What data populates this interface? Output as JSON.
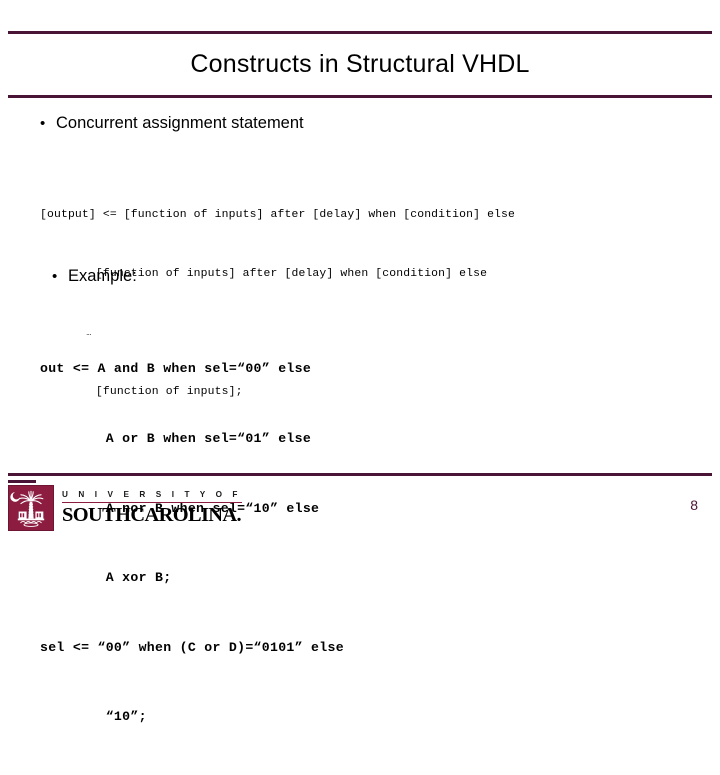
{
  "slide": {
    "title": "Constructs in Structural VHDL",
    "page_number": "8",
    "accent_color": "#4a1436",
    "logo_color": "#8c1d40"
  },
  "bullets": [
    {
      "marker": "•",
      "label": "Concurrent assignment statement"
    },
    {
      "marker": "•",
      "label": "Example:"
    }
  ],
  "code_syntax": {
    "line1": "[output] <= [function of inputs] after [delay] when [condition] else",
    "line2": "        [function of inputs] after [delay] when [condition] else",
    "line3": "        …",
    "line4": "        [function of inputs];"
  },
  "code_example": {
    "line1": "out <= A and B when sel=“00” else",
    "line2": "        A or B when sel=“01” else",
    "line3": "        A nor B when sel=“10” else",
    "line4": "        A xor B;",
    "line5": "sel <= “00” when (C or D)=“0101” else",
    "line6": "        “10”;"
  },
  "footer": {
    "logo_university_line": "U N I V E R S I T Y   O F",
    "logo_name_line": "SOUTHCAROLINA.",
    "logo_icon": "palmetto-tree-crescent-icon"
  }
}
